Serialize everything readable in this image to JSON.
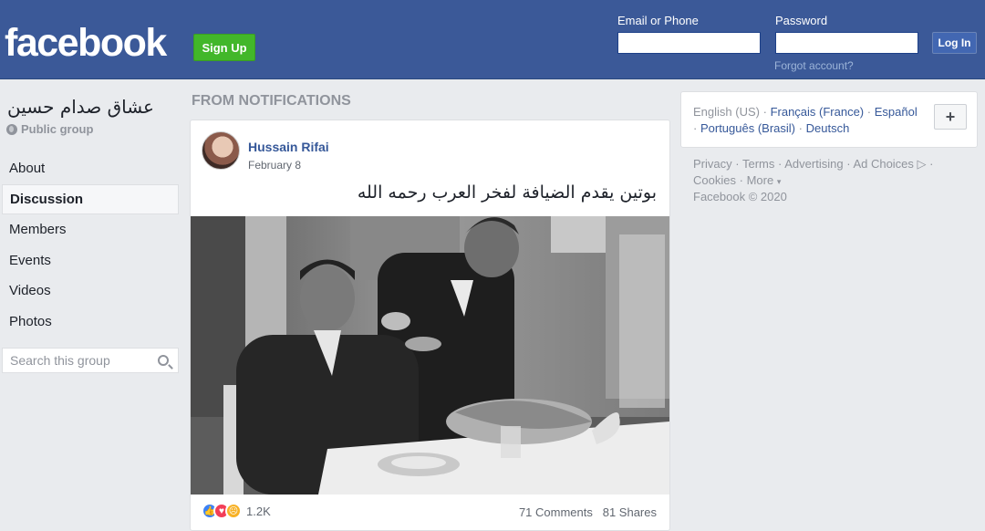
{
  "header": {
    "logo": "facebook",
    "signup_label": "Sign Up",
    "email_label": "Email or Phone",
    "password_label": "Password",
    "login_label": "Log In",
    "forgot_label": "Forgot account?"
  },
  "group": {
    "name": "عشاق صدام حسين",
    "type": "Public group"
  },
  "nav": [
    {
      "label": "About"
    },
    {
      "label": "Discussion"
    },
    {
      "label": "Members"
    },
    {
      "label": "Events"
    },
    {
      "label": "Videos"
    },
    {
      "label": "Photos"
    }
  ],
  "search": {
    "placeholder": "Search this group"
  },
  "feed": {
    "section_title": "FROM NOTIFICATIONS",
    "post": {
      "author": "Hussain Rifai",
      "date": "February 8",
      "text": "بوتين يقدم الضيافة لفخر العرب رحمه الله",
      "reactions_count": "1.2K",
      "comments": "71 Comments",
      "shares": "81 Shares"
    }
  },
  "sidebar": {
    "lang_current": "English (US)",
    "lang_1": "Français (France)",
    "lang_2": "Español",
    "lang_3": "Português (Brasil)",
    "lang_4": "Deutsch",
    "sep": "·",
    "plus": "+",
    "footer_privacy": "Privacy",
    "footer_terms": "Terms",
    "footer_advertising": "Advertising",
    "footer_adchoices": "Ad Choices",
    "footer_cookies": "Cookies",
    "footer_more": "More",
    "copyright": "Facebook © 2020"
  },
  "colors": {
    "brand_blue": "#3b5998",
    "signup_green": "#42b72a",
    "link_blue": "#365899"
  }
}
